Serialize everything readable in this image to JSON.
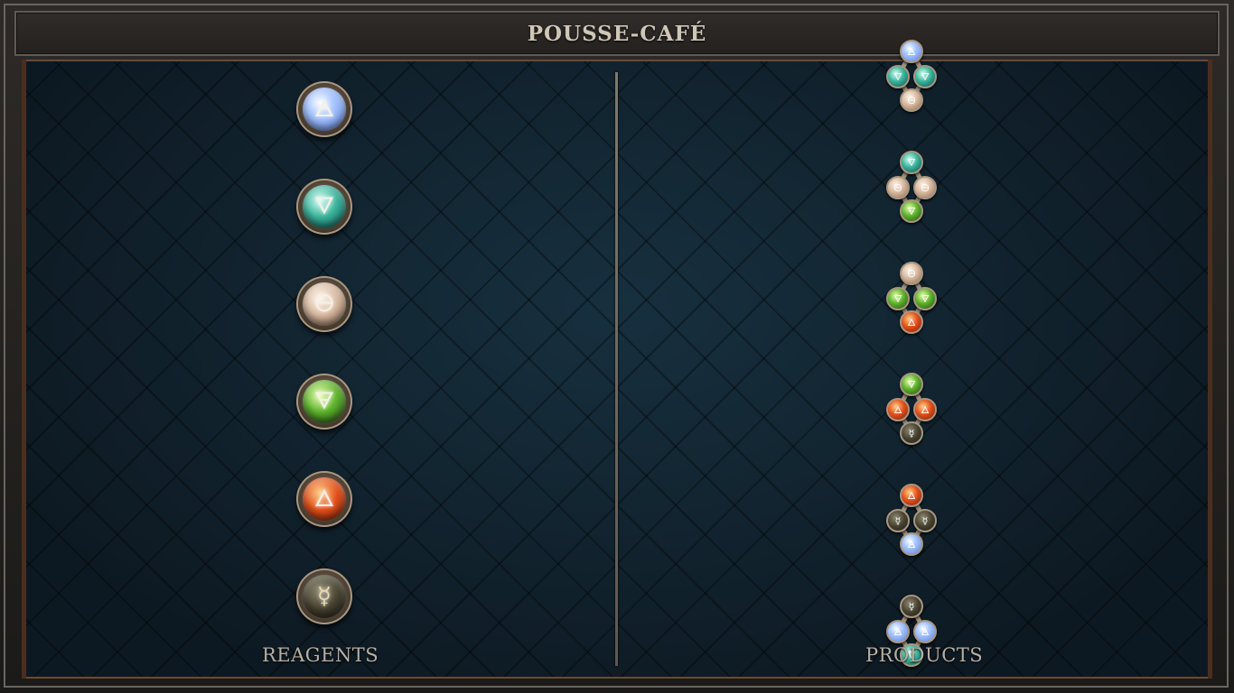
{
  "title": "POUSSE-CAFÉ",
  "columns": {
    "reagents_label": "REAGENTS",
    "products_label": "PRODUCTS"
  },
  "reagents": [
    {
      "element": "air",
      "glyph": "🜁",
      "color": "#a9c7ff"
    },
    {
      "element": "water",
      "glyph": "🜄",
      "color": "#39b39a"
    },
    {
      "element": "salt",
      "glyph": "🜔",
      "color": "#d8b9a0"
    },
    {
      "element": "earth",
      "glyph": "🜃",
      "color": "#5db22c"
    },
    {
      "element": "fire",
      "glyph": "🜂",
      "color": "#e2501a"
    },
    {
      "element": "quicksilver",
      "glyph": "☿",
      "color": "#45412f"
    }
  ],
  "products": [
    {
      "top": "air",
      "left": "water",
      "right": "water",
      "bottom": "salt"
    },
    {
      "top": "water",
      "left": "salt",
      "right": "salt",
      "bottom": "earth"
    },
    {
      "top": "salt",
      "left": "earth",
      "right": "earth",
      "bottom": "fire"
    },
    {
      "top": "earth",
      "left": "fire",
      "right": "fire",
      "bottom": "quicksilver"
    },
    {
      "top": "fire",
      "left": "quicksilver",
      "right": "quicksilver",
      "bottom": "air"
    },
    {
      "top": "quicksilver",
      "left": "air",
      "right": "air",
      "bottom": "water"
    }
  ]
}
